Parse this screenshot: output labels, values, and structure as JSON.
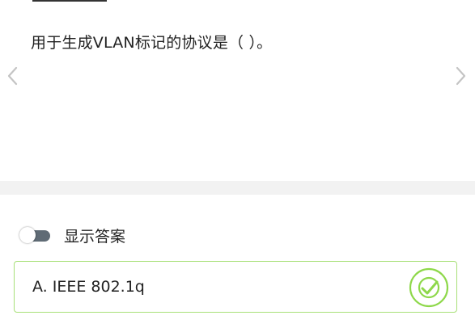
{
  "question": {
    "text": "用于生成VLAN标记的协议是（ ）。"
  },
  "navigation": {
    "prev_icon": "chevron-left-icon",
    "next_icon": "chevron-right-icon"
  },
  "answer_toggle": {
    "label": "显示答案",
    "enabled": false
  },
  "options": [
    {
      "label": "A. IEEE 802.1q",
      "is_correct": true,
      "status_icon": "check-circle-icon"
    }
  ],
  "colors": {
    "correct_accent": "#8ed84a",
    "correct_border": "#a8e078",
    "toggle_track": "#5f6b75",
    "band": "#f2f2f2",
    "text": "#222222"
  }
}
